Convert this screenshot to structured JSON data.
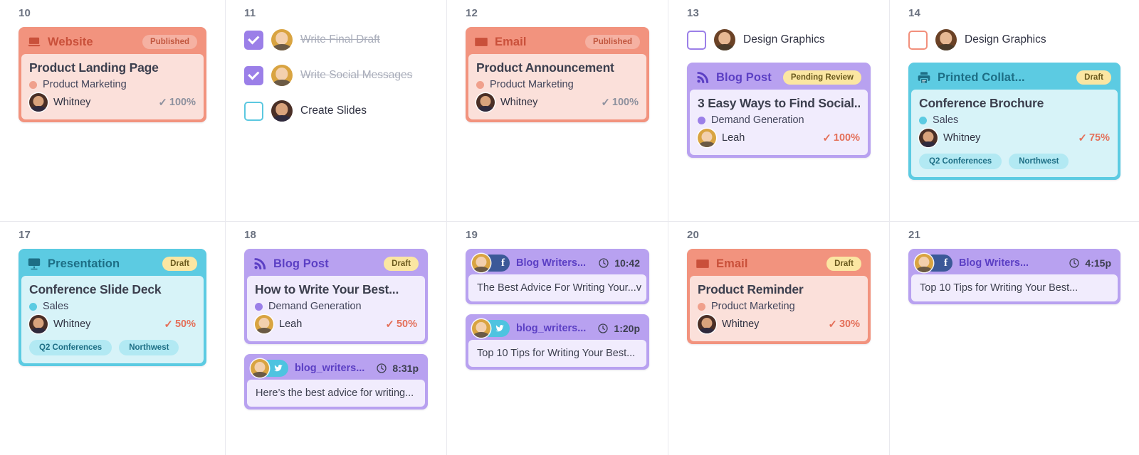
{
  "colors": {
    "coral": "#f2937e",
    "coral_light": "#fbe0da",
    "coral_text": "#e4705a",
    "purple": "#b8a1f0",
    "purple_light": "#f1ecfd",
    "purple_text": "#6a43c9",
    "cyan": "#5ccbe2",
    "cyan_light": "#d7f3f8",
    "cyan_text": "#2a7f96",
    "yellow_pill": "#fbe6a2",
    "yellow_pill_text": "#6b5a1e",
    "grey_pct": "#8e919e",
    "orange_pct": "#e4705a"
  },
  "cells": [
    {
      "day": "10",
      "tasks": [],
      "cards": [
        {
          "kind": "content",
          "type": "Website",
          "icon": "laptop-icon",
          "status": "Published",
          "status_style": "ghost-coral",
          "title": "Product Landing Page",
          "campaign": "Product Marketing",
          "campaign_color": "#f0a08c",
          "owner": "Whitney",
          "avatar": "dark",
          "percent": "100%",
          "percent_style": "grey",
          "theme": "coral",
          "tags": []
        }
      ]
    },
    {
      "day": "11",
      "tasks": [
        {
          "label": "Write Final Draft",
          "state": "done",
          "avatar": "blonde"
        },
        {
          "label": "Write Social Messages",
          "state": "done",
          "avatar": "blonde"
        },
        {
          "label": "Create Slides",
          "state": "open",
          "box": "cyan",
          "avatar": "dark"
        }
      ],
      "cards": []
    },
    {
      "day": "12",
      "tasks": [],
      "cards": [
        {
          "kind": "content",
          "type": "Email",
          "icon": "envelope-icon",
          "status": "Published",
          "status_style": "ghost-coral",
          "title": "Product Announcement",
          "campaign": "Product Marketing",
          "campaign_color": "#f0a08c",
          "owner": "Whitney",
          "avatar": "dark",
          "percent": "100%",
          "percent_style": "grey",
          "theme": "coral",
          "tags": []
        }
      ]
    },
    {
      "day": "13",
      "tasks": [
        {
          "label": "Design Graphics",
          "state": "open",
          "box": "purple",
          "avatar": "curly"
        }
      ],
      "cards": [
        {
          "kind": "content",
          "type": "Blog Post",
          "icon": "rss-icon",
          "status": "Pending Review",
          "status_style": "yellow",
          "title": "3 Easy Ways to Find Social...",
          "campaign": "Demand Generation",
          "campaign_color": "#9b7fe8",
          "owner": "Leah",
          "avatar": "blonde",
          "percent": "100%",
          "percent_style": "orange",
          "theme": "purple",
          "tags": []
        }
      ]
    },
    {
      "day": "14",
      "tasks": [
        {
          "label": "Design Graphics",
          "state": "open",
          "box": "coral",
          "avatar": "curly"
        }
      ],
      "cards": [
        {
          "kind": "content",
          "type": "Printed Collat...",
          "icon": "printer-icon",
          "status": "Draft",
          "status_style": "yellow",
          "title": "Conference Brochure",
          "campaign": "Sales",
          "campaign_color": "#5ccbe2",
          "owner": "Whitney",
          "avatar": "dark",
          "percent": "75%",
          "percent_style": "orange",
          "theme": "cyan",
          "tags": [
            "Q2 Conferences",
            "Northwest"
          ]
        }
      ]
    },
    {
      "day": "17",
      "tasks": [],
      "cards": [
        {
          "kind": "content",
          "type": "Presentation",
          "icon": "presentation-icon",
          "status": "Draft",
          "status_style": "yellow",
          "title": "Conference Slide Deck",
          "campaign": "Sales",
          "campaign_color": "#5ccbe2",
          "owner": "Whitney",
          "avatar": "dark",
          "percent": "50%",
          "percent_style": "orange",
          "theme": "cyan",
          "tags": [
            "Q2 Conferences",
            "Northwest"
          ]
        }
      ]
    },
    {
      "day": "18",
      "tasks": [],
      "cards": [
        {
          "kind": "content",
          "type": "Blog Post",
          "icon": "rss-icon",
          "status": "Draft",
          "status_style": "yellow",
          "title": "How to Write Your Best...",
          "campaign": "Demand Generation",
          "campaign_color": "#9b7fe8",
          "owner": "Leah",
          "avatar": "blonde",
          "percent": "50%",
          "percent_style": "orange",
          "theme": "purple",
          "tags": []
        },
        {
          "kind": "social",
          "network": "twitter",
          "handle": "blog_writers...",
          "time": "8:31p",
          "text": "Here’s the best advice for writing...",
          "avatar": "blonde"
        }
      ]
    },
    {
      "day": "19",
      "tasks": [],
      "cards": [
        {
          "kind": "social",
          "network": "facebook",
          "handle": "Blog Writers...",
          "time": "10:42",
          "text": "The Best Advice For Writing Your...v",
          "avatar": "blonde"
        },
        {
          "kind": "social",
          "network": "twitter",
          "handle": "blog_writers...",
          "time": "1:20p",
          "text": "Top 10 Tips for Writing Your Best...",
          "avatar": "blonde"
        }
      ]
    },
    {
      "day": "20",
      "tasks": [],
      "cards": [
        {
          "kind": "content",
          "type": "Email",
          "icon": "envelope-icon",
          "status": "Draft",
          "status_style": "yellow",
          "title": "Product Reminder",
          "campaign": "Product Marketing",
          "campaign_color": "#f0a08c",
          "owner": "Whitney",
          "avatar": "dark",
          "percent": "30%",
          "percent_style": "orange",
          "theme": "coral",
          "tags": []
        }
      ]
    },
    {
      "day": "21",
      "tasks": [],
      "cards": [
        {
          "kind": "social",
          "network": "facebook",
          "handle": "Blog Writers...",
          "time": "4:15p",
          "text": "Top 10 Tips for Writing Your Best...",
          "avatar": "blonde"
        }
      ]
    }
  ]
}
